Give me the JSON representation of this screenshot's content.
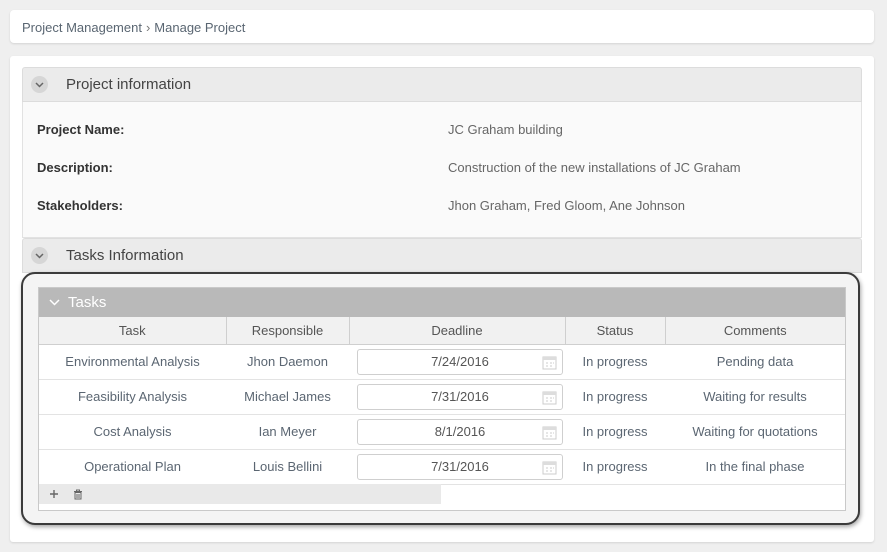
{
  "breadcrumb": {
    "parent": "Project Management",
    "separator": "›",
    "current": "Manage Project"
  },
  "project_panel": {
    "title": "Project information",
    "fields": [
      {
        "label": "Project Name:",
        "value": "JC Graham building"
      },
      {
        "label": "Description:",
        "value": "Construction of the new installations of JC Graham"
      },
      {
        "label": "Stakeholders:",
        "value": "Jhon Graham, Fred Gloom, Ane Johnson"
      }
    ]
  },
  "tasks_panel": {
    "title": "Tasks Information",
    "grid_title": "Tasks",
    "columns": [
      "Task",
      "Responsible",
      "Deadline",
      "Status",
      "Comments"
    ],
    "rows": [
      {
        "task": "Environmental Analysis",
        "responsible": "Jhon Daemon",
        "deadline": "7/24/2016",
        "status": "In progress",
        "comments": "Pending data"
      },
      {
        "task": "Feasibility Analysis",
        "responsible": "Michael James",
        "deadline": "7/31/2016",
        "status": "In progress",
        "comments": "Waiting for results"
      },
      {
        "task": "Cost Analysis",
        "responsible": "Ian Meyer",
        "deadline": "8/1/2016",
        "status": "In progress",
        "comments": "Waiting for quotations"
      },
      {
        "task": "Operational Plan",
        "responsible": "Louis Bellini",
        "deadline": "7/31/2016",
        "status": "In progress",
        "comments": "In the final phase"
      }
    ],
    "footer_icons": [
      "plus-icon",
      "trash-icon"
    ]
  },
  "colors": {
    "highlight_border": "#3b3b3b",
    "grid_header": "#b9b9b9"
  }
}
